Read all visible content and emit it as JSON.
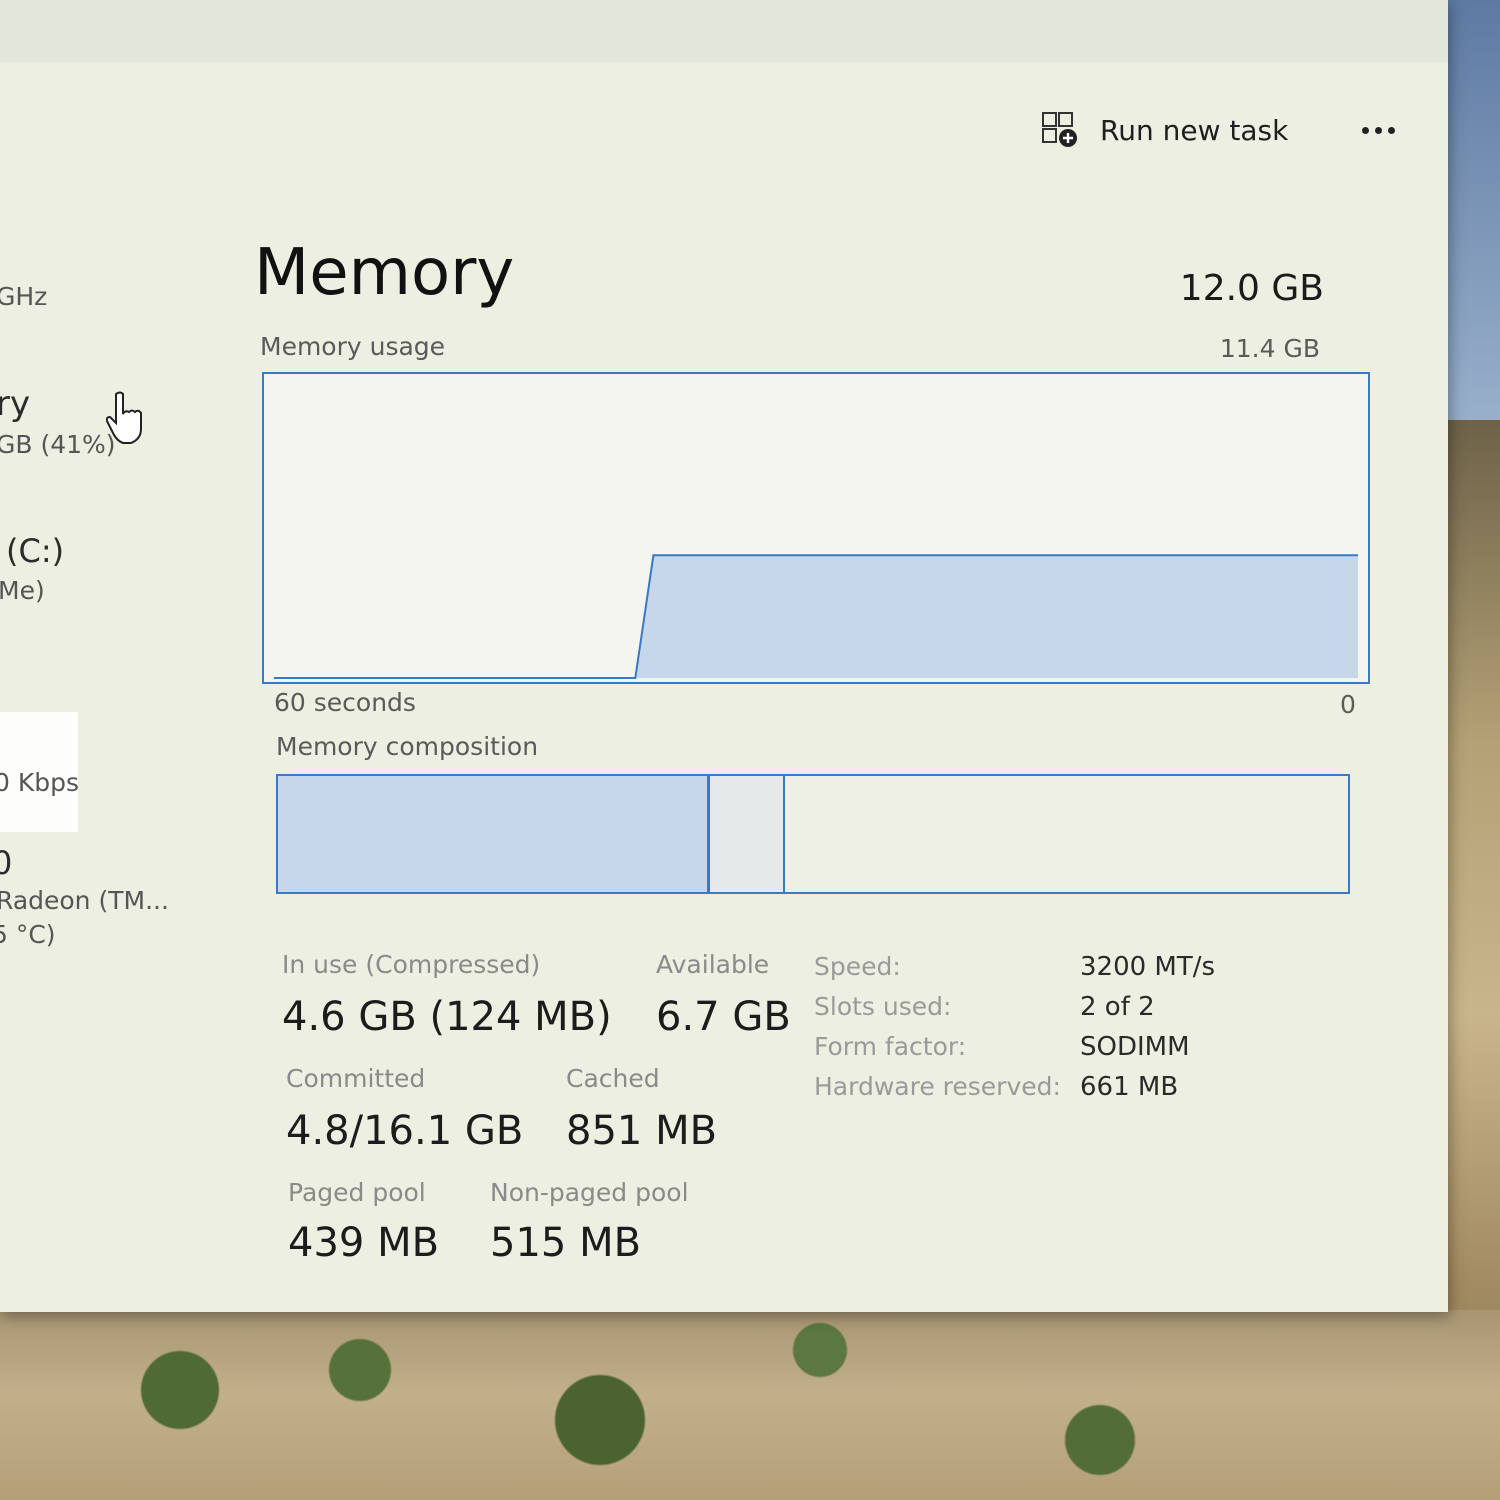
{
  "sidebar": {
    "cpu_speed_fragment": "GHz",
    "memory_label_fragment": "ry",
    "memory_usage_fragment": "GB (41%)",
    "disk_label_fragment": "(C:)",
    "disk_type_fragment": "Me)",
    "network_speed_fragment": "0 Kbps",
    "gpu_label_fragment": "0",
    "gpu_name_fragment": "Radeon (TM...",
    "gpu_temp_fragment": "5 °C)"
  },
  "toolbar": {
    "run_new_task_label": "Run new task"
  },
  "header": {
    "title": "Memory",
    "total": "12.0 GB"
  },
  "usage_graph": {
    "label": "Memory usage",
    "max_label": "11.4 GB",
    "left_axis_label": "60 seconds",
    "right_axis_label": "0",
    "max_gb": 11.4,
    "samples_gb": [
      0,
      0,
      0,
      0,
      0,
      0,
      0,
      0,
      0,
      0,
      0,
      0,
      0,
      0,
      0,
      0,
      0,
      0,
      0,
      0,
      0,
      4.6,
      4.6,
      4.6,
      4.6,
      4.6,
      4.6,
      4.6,
      4.6,
      4.6,
      4.6,
      4.6,
      4.6,
      4.6,
      4.6,
      4.6,
      4.6,
      4.6,
      4.6,
      4.6,
      4.6,
      4.6,
      4.6,
      4.6,
      4.6,
      4.6,
      4.6,
      4.6,
      4.6,
      4.6,
      4.6,
      4.6,
      4.6,
      4.6,
      4.6,
      4.6,
      4.6,
      4.6,
      4.6,
      4.6,
      4.6
    ]
  },
  "composition": {
    "label": "Memory composition",
    "in_use_gb": 4.6,
    "modified_gb": 0.8,
    "standby_gb": 6.0
  },
  "stats": {
    "in_use_label": "In use (Compressed)",
    "in_use_value": "4.6 GB (124 MB)",
    "available_label": "Available",
    "available_value": "6.7 GB",
    "committed_label": "Committed",
    "committed_value": "4.8/16.1 GB",
    "cached_label": "Cached",
    "cached_value": "851 MB",
    "paged_pool_label": "Paged pool",
    "paged_pool_value": "439 MB",
    "nonpaged_pool_label": "Non-paged pool",
    "nonpaged_pool_value": "515 MB"
  },
  "specs": {
    "speed_label": "Speed:",
    "speed_value": "3200 MT/s",
    "slots_label": "Slots used:",
    "slots_value": "2 of 2",
    "form_factor_label": "Form factor:",
    "form_factor_value": "SODIMM",
    "hw_reserved_label": "Hardware reserved:",
    "hw_reserved_value": "661 MB"
  },
  "colors": {
    "accent": "#3a78c8",
    "graph_fill": "#c6d7ea",
    "window_bg": "#ecefe1"
  },
  "icons": [
    "run-task-icon",
    "more-options-icon",
    "hand-cursor-icon"
  ]
}
